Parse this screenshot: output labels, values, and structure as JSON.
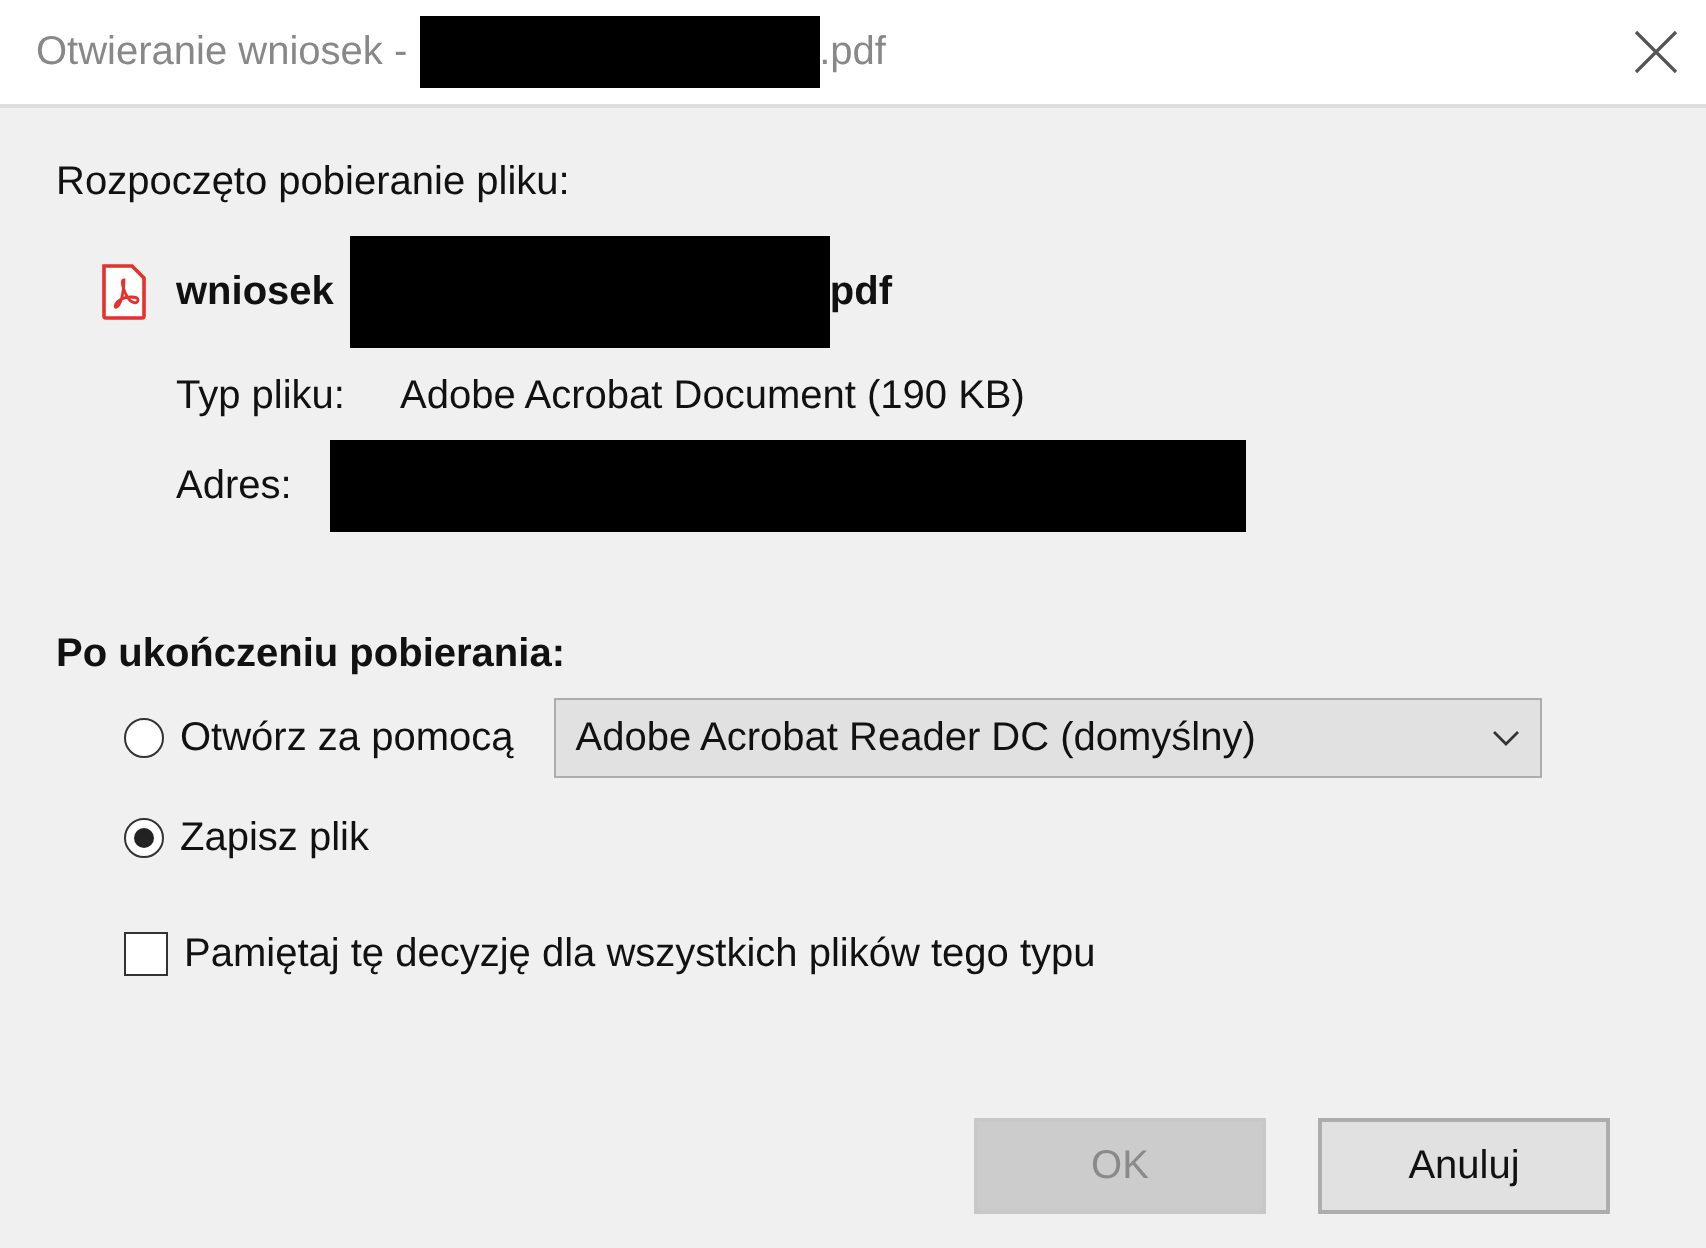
{
  "window": {
    "title_start": "Otwieranie wniosek -",
    "title_end": ".pdf"
  },
  "intro": "Rozpoczęto pobieranie pliku:",
  "file": {
    "name_start": "wniosek",
    "name_end": "pdf",
    "type_label": "Typ pliku:",
    "type_value": "Adobe Acrobat Document (190 KB)",
    "address_label": "Adres:"
  },
  "after_download": {
    "heading": "Po ukończeniu pobierania:",
    "options": [
      {
        "kind": "radio",
        "label": "Otwórz za pomocą",
        "selected": false,
        "dropdown": "Adobe Acrobat Reader DC (domyślny)"
      },
      {
        "kind": "radio",
        "label": "Zapisz plik",
        "selected": true
      }
    ],
    "remember": {
      "label": "Pamiętaj tę decyzję dla wszystkich plików tego typu",
      "checked": false
    }
  },
  "buttons": [
    {
      "label": "OK",
      "disabled": true
    },
    {
      "label": "Anuluj",
      "disabled": false
    }
  ]
}
